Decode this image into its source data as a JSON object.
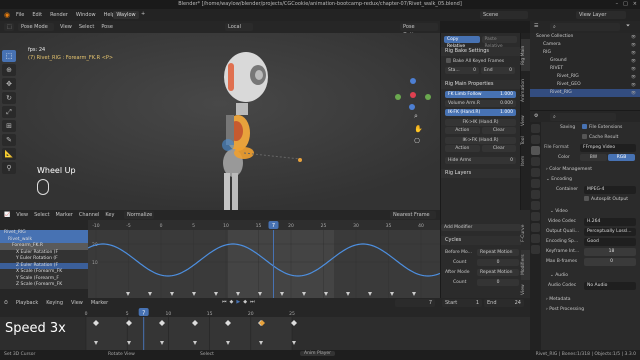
{
  "window_title": "Blender* [/home/waylow/blender/projects/CGCookie/animation-bootcamp-redux/chapter-07/Rivet_walk_05.blend]",
  "topbar": {
    "menus": [
      "File",
      "Edit",
      "Render",
      "Window",
      "Help"
    ],
    "workspace_tab": "Waylow",
    "scene": "Scene",
    "view_layer": "View Layer"
  },
  "viewport": {
    "mode": "Pose Mode",
    "menus": [
      "View",
      "Select",
      "Pose"
    ],
    "transform_orientation": "Local",
    "fps": "fps: 24",
    "object_info": "(7) Rivet_RIG : Forearm_FK.R <P>",
    "wheel_label": "Wheel Up",
    "pose_options": "Pose Options"
  },
  "npanel": {
    "copy_relative": "Copy Relative",
    "paste_relative": "Paste Relative",
    "rig_bake_title": "Rig Bake Settings",
    "bake_all": "Bake All Keyed Frames",
    "sta": "Sta...",
    "sta_val": "0",
    "end": "End",
    "end_val": "0",
    "rig_main_title": "Rig Main Properties",
    "fk_limb_follow": "FK Limb Follow",
    "fk_limb_follow_val": "1.000",
    "volume_arm": "Volume Arm.R",
    "volume_arm_val": "0.000",
    "ik_fk": "IK-FK (Hand.R)",
    "ik_fk_val": "1.000",
    "fk_ik": "FK->IK (Hand.R)",
    "ik_fk_snap": "IK->FK (Hand.R)",
    "action": "Action",
    "clear": "Clear",
    "hide_arms": "Hide Arms",
    "hide_arms_val": "0",
    "rig_layers": "Rig Layers",
    "tabs": [
      "Rig Main",
      "Animation",
      "View",
      "Tool",
      "Item"
    ]
  },
  "graph_editor": {
    "menus": [
      "View",
      "Select",
      "Marker",
      "Channel",
      "Key"
    ],
    "normalize": "Normalize",
    "ruler": [
      "-10",
      "-5",
      "0",
      "5",
      "10",
      "15",
      "20",
      "25",
      "30",
      "35",
      "40"
    ],
    "y_labels": [
      "20",
      "10"
    ],
    "current_frame": "7",
    "channels": [
      {
        "name": "Rivet_RIG",
        "level": 0,
        "color": "#4772b3"
      },
      {
        "name": "Rivet_walk",
        "level": 1,
        "color": "#4772b3"
      },
      {
        "name": "Forearm_FK.R",
        "level": 2,
        "color": "#5a5a5a"
      },
      {
        "name": "X Euler Rotation (F",
        "level": 3,
        "color": "#333"
      },
      {
        "name": "Y Euler Rotation (F",
        "level": 3,
        "color": "#333"
      },
      {
        "name": "Z Euler Rotation (F",
        "level": 3,
        "color": "#3b5f9a"
      },
      {
        "name": "X Scale (Forearm_FK",
        "level": 3,
        "color": "#333"
      },
      {
        "name": "Y Scale (Forearm_F",
        "level": 3,
        "color": "#333"
      },
      {
        "name": "Z Scale (Forearm_FK",
        "level": 3,
        "color": "#333"
      }
    ],
    "nearest_frame": "Nearest Frame",
    "add_modifier": "Add Modifier",
    "cycles": "Cycles",
    "before_mode": "Before Mo...",
    "before_mode_val": "Repeat Motion",
    "count": "Count",
    "count_val": "0",
    "after_mode": "After Mode",
    "after_mode_val": "Repeat Motion",
    "count2_val": "0",
    "side_tabs": [
      "F-Curve",
      "Modifiers",
      "View"
    ]
  },
  "timeline": {
    "menus": [
      "Playback",
      "Keying",
      "View",
      "Marker"
    ],
    "current": "7",
    "start_label": "Start",
    "start_val": "1",
    "end_label": "End",
    "end_val": "24",
    "ruler": [
      "0",
      "5",
      "10",
      "15",
      "20",
      "25"
    ],
    "speed_overlay": "Speed 3x"
  },
  "outliner": {
    "items": [
      {
        "name": "Scene Collection",
        "level": 0
      },
      {
        "name": "Camera",
        "level": 1
      },
      {
        "name": "RIG",
        "level": 1
      },
      {
        "name": "Ground",
        "level": 2
      },
      {
        "name": "RIVET",
        "level": 2
      },
      {
        "name": "Rivet_RIG",
        "level": 3
      },
      {
        "name": "Rivet_GEO",
        "level": 3
      },
      {
        "name": "Rivet_RIG",
        "level": 2,
        "selected": true
      }
    ]
  },
  "properties": {
    "saving": "Saving",
    "file_extensions": "File Extensions",
    "cache_result": "Cache Result",
    "file_format": "File Format",
    "file_format_val": "FFmpeg Video",
    "color": "Color",
    "bw": "BW",
    "rgb": "RGB",
    "color_management": "Color Management",
    "encoding": "Encoding",
    "container": "Container",
    "container_val": "MPEG-4",
    "autosplit": "Autosplit Output",
    "video": "Video",
    "video_codec": "Video Codec",
    "video_codec_val": "H.264",
    "output_quality": "Output Quali...",
    "output_quality_val": "Perceptually Lossl...",
    "encoding_speed": "Encoding Sp...",
    "encoding_speed_val": "Good",
    "keyframe_interval": "Keyframe Int...",
    "keyframe_interval_val": "18",
    "max_bframes": "Max B-frames",
    "max_bframes_val": "0",
    "audio": "Audio",
    "audio_codec": "Audio Codec",
    "audio_codec_val": "No Audio",
    "metadata": "Metadata",
    "post_processing": "Post Processing"
  },
  "statusbar": {
    "left": "Set 3D Cursor",
    "rotate": "Rotate View",
    "select": "Select",
    "anim_player": "Anim Player",
    "right": "Rivet_RIG | Bones:1/318 | Objects:1/5 | 3.3.0"
  },
  "accent": "#4772b3"
}
